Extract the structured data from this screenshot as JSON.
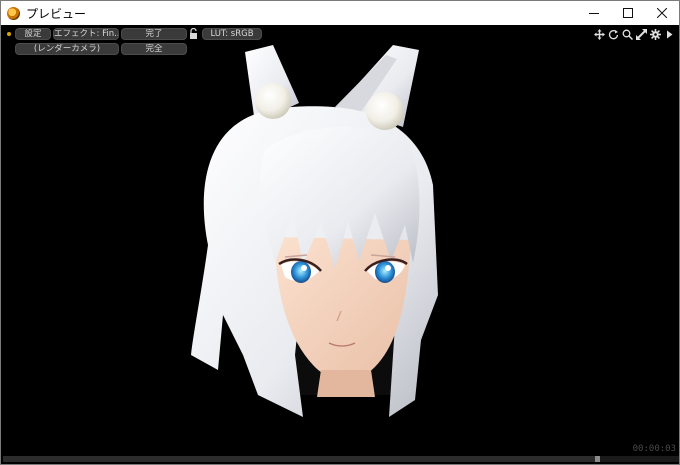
{
  "window": {
    "title": "プレビュー"
  },
  "toolbar": {
    "row1": {
      "settings_label": "設定",
      "effect_label": "エフェクト: Fin...",
      "done_label": "完了",
      "lut_label": "LUT: sRGB"
    },
    "row2": {
      "camera_label": "(レンダーカメラ)",
      "complete_label": "完全"
    },
    "right_icons": [
      "move-icon",
      "rotate-icon",
      "zoom-icon",
      "expand-icon",
      "gear-icon",
      "play-arrow-icon"
    ]
  },
  "playback": {
    "timestamp": "00:00:03",
    "progress": 0.875
  },
  "colors": {
    "background": "#000000",
    "button_bg": "#3a3a3a",
    "button_text": "#d8d8d8",
    "accent_dot": "#d9a400"
  }
}
